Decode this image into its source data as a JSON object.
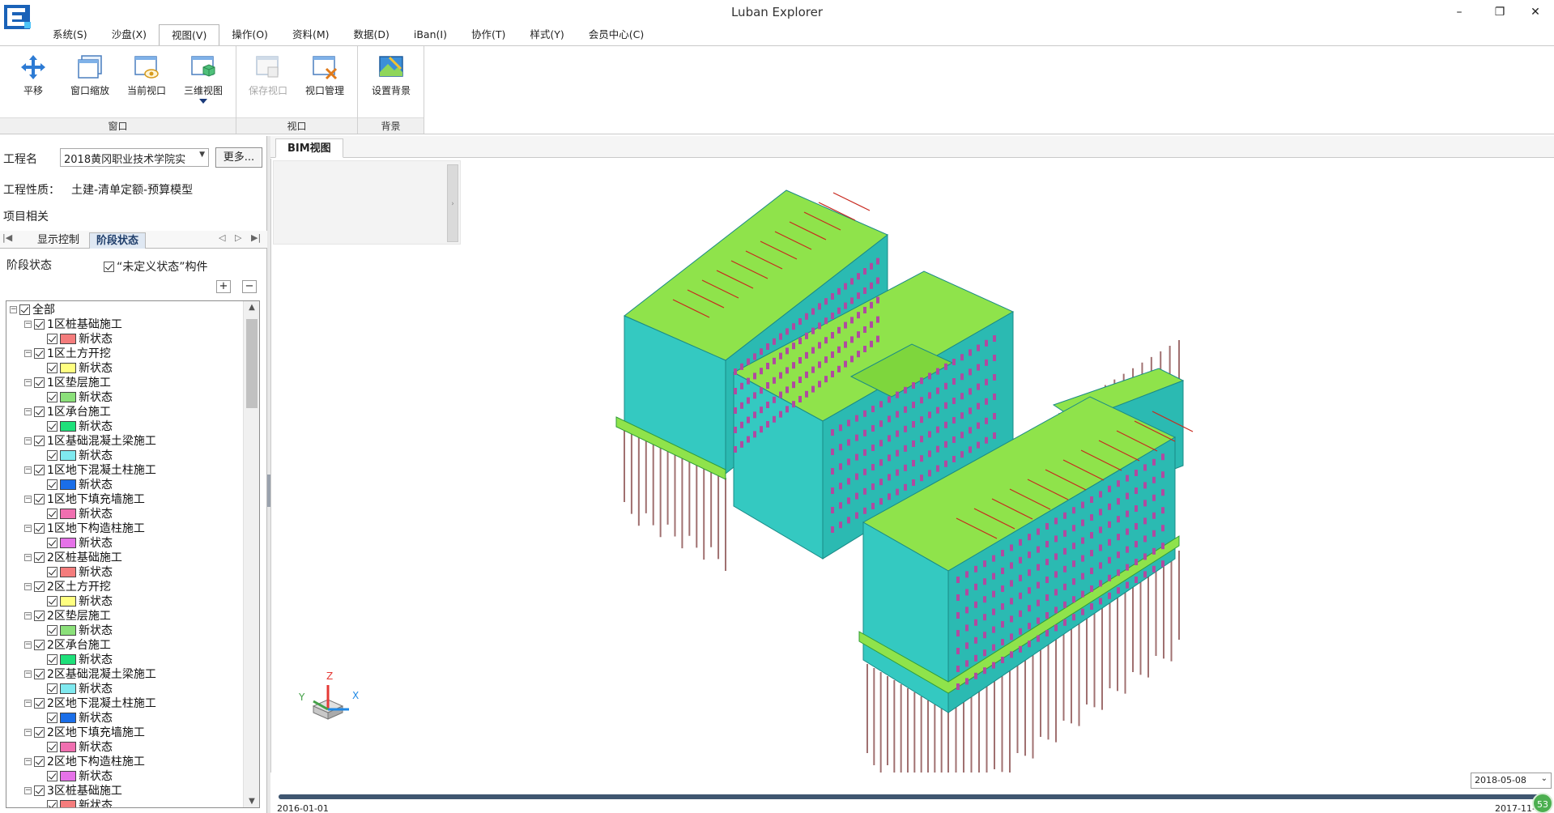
{
  "window": {
    "title": "Luban Explorer",
    "minimize": "–",
    "restore": "❐",
    "close": "✕"
  },
  "menu": [
    {
      "label": "系统(S)"
    },
    {
      "label": "沙盘(X)"
    },
    {
      "label": "视图(V)",
      "active": true
    },
    {
      "label": "操作(O)"
    },
    {
      "label": "资料(M)"
    },
    {
      "label": "数据(D)"
    },
    {
      "label": "iBan(I)"
    },
    {
      "label": "协作(T)"
    },
    {
      "label": "样式(Y)"
    },
    {
      "label": "会员中心(C)"
    }
  ],
  "ribbon": {
    "groups": [
      {
        "label": "窗口",
        "buttons": [
          "平移",
          "窗口缩放",
          "当前视口",
          "三维视图"
        ]
      },
      {
        "label": "视口",
        "buttons": [
          "保存视口",
          "视口管理"
        ]
      },
      {
        "label": "背景",
        "buttons": [
          "设置背景"
        ]
      }
    ],
    "disabled_buttons": [
      "保存视口"
    ]
  },
  "left_panel": {
    "project_name_label": "工程名",
    "project_name_value": "2018黄冈职业技术学院实",
    "more_button": "更多...",
    "project_type_label": "工程性质：",
    "project_type_value": "土建-清单定额-预算模型",
    "project_related": "项目相关",
    "tabs": [
      "显示控制",
      "阶段状态"
    ],
    "active_tab": "阶段状态",
    "stage_header": "阶段状态",
    "undefined_check": "“未定义状态”构件",
    "expand_btn": "+",
    "collapse_btn": "−"
  },
  "tree": {
    "root": "全部",
    "child_label": "新状态",
    "stages": [
      {
        "label": "1区桩基础施工",
        "color": "#f47c7c"
      },
      {
        "label": "1区土方开挖",
        "color": "#ffff80"
      },
      {
        "label": "1区垫层施工",
        "color": "#8be07a"
      },
      {
        "label": "1区承台施工",
        "color": "#1ee07a"
      },
      {
        "label": "1区基础混凝土梁施工",
        "color": "#7fe9ef"
      },
      {
        "label": "1区地下混凝土柱施工",
        "color": "#1a6ee8"
      },
      {
        "label": "1区地下填充墙施工",
        "color": "#f06fb0"
      },
      {
        "label": "1区地下构造柱施工",
        "color": "#e572e8"
      },
      {
        "label": "2区桩基础施工",
        "color": "#f47c7c"
      },
      {
        "label": "2区土方开挖",
        "color": "#ffff80"
      },
      {
        "label": "2区垫层施工",
        "color": "#8be07a"
      },
      {
        "label": "2区承台施工",
        "color": "#1ee07a"
      },
      {
        "label": "2区基础混凝土梁施工",
        "color": "#7fe9ef"
      },
      {
        "label": "2区地下混凝土柱施工",
        "color": "#1a6ee8"
      },
      {
        "label": "2区地下填充墙施工",
        "color": "#f06fb0"
      },
      {
        "label": "2区地下构造柱施工",
        "color": "#e572e8"
      },
      {
        "label": "3区桩基础施工",
        "color": "#f47c7c"
      }
    ]
  },
  "view": {
    "tab": "BIM视图",
    "axis": {
      "x": "X",
      "y": "Y",
      "z": "Z"
    }
  },
  "timeline": {
    "current_date": "2018-05-08",
    "start_date": "2016-01-01",
    "end_date": "2017-11-",
    "speed": "53",
    "progress": 1.0
  },
  "colors": {
    "building_cyan": "#32c8c0",
    "building_green": "#8fe34b",
    "pile": "#a07070",
    "window_magenta": "#b04aa0",
    "rebar_red": "#c8281e"
  }
}
